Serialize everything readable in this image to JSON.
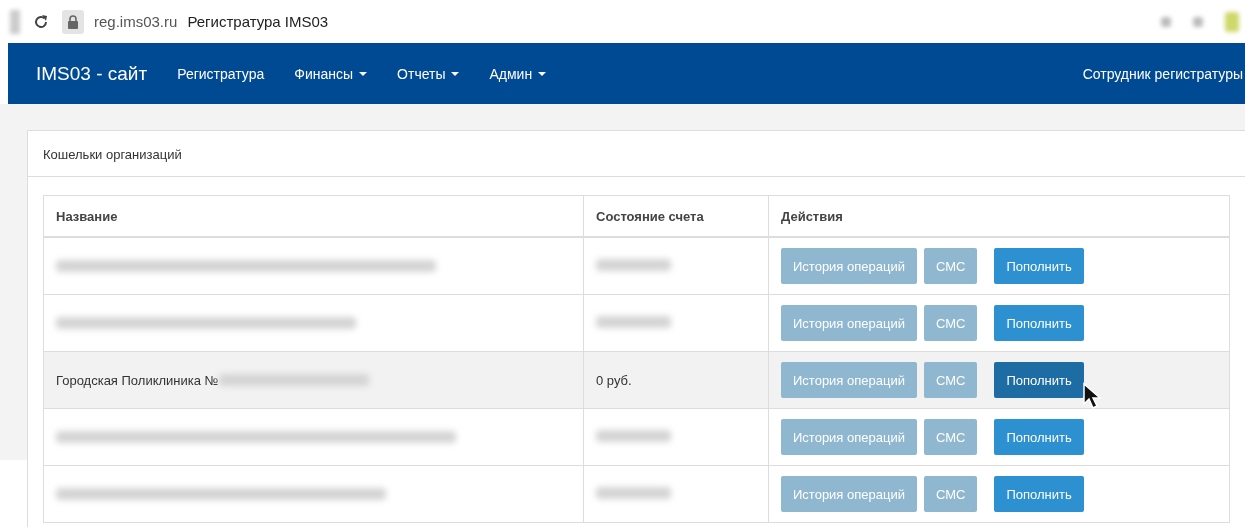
{
  "browser": {
    "url": "reg.ims03.ru",
    "title": "Регистратура IMS03"
  },
  "navbar": {
    "brand": "IMS03 - сайт",
    "items": [
      {
        "label": "Регистратура",
        "dropdown": false
      },
      {
        "label": "Финансы",
        "dropdown": true
      },
      {
        "label": "Отчеты",
        "dropdown": true
      },
      {
        "label": "Админ",
        "dropdown": true
      }
    ],
    "user": "Сотрудник регистратуры"
  },
  "panel": {
    "title": "Кошельки организаций"
  },
  "table": {
    "columns": [
      "Название",
      "Состояние счета",
      "Действия"
    ],
    "rows": [
      {
        "name_blurred": true,
        "balance_blurred": true,
        "highlighted": false,
        "actions": [
          {
            "kind": "history",
            "label": "История операций",
            "hovered": false
          },
          {
            "kind": "sms",
            "label": "СМС",
            "hovered": false
          },
          {
            "kind": "topup",
            "label": "Пополнить",
            "hovered": false
          }
        ]
      },
      {
        "name_blurred": true,
        "balance_blurred": true,
        "highlighted": false,
        "actions": [
          {
            "kind": "history",
            "label": "История операций",
            "hovered": false
          },
          {
            "kind": "sms",
            "label": "СМС",
            "hovered": false
          },
          {
            "kind": "topup",
            "label": "Пополнить",
            "hovered": false
          }
        ]
      },
      {
        "name": "Городская Поликлиника №",
        "name_blurred": true,
        "balance": "0 руб.",
        "balance_blurred": false,
        "highlighted": true,
        "actions": [
          {
            "kind": "history",
            "label": "История операций",
            "hovered": false
          },
          {
            "kind": "sms",
            "label": "СМС",
            "hovered": false
          },
          {
            "kind": "topup",
            "label": "Пополнить",
            "hovered": true
          }
        ]
      },
      {
        "name_blurred": true,
        "balance_blurred": true,
        "highlighted": false,
        "actions": [
          {
            "kind": "history",
            "label": "История операций",
            "hovered": false
          },
          {
            "kind": "sms",
            "label": "СМС",
            "hovered": false
          },
          {
            "kind": "topup",
            "label": "Пополнить",
            "hovered": false
          }
        ]
      },
      {
        "name_blurred": true,
        "balance_blurred": true,
        "highlighted": false,
        "actions": [
          {
            "kind": "history",
            "label": "История операций",
            "hovered": false
          },
          {
            "kind": "sms",
            "label": "СМС",
            "hovered": false
          },
          {
            "kind": "topup",
            "label": "Пополнить",
            "hovered": false
          }
        ]
      }
    ]
  }
}
